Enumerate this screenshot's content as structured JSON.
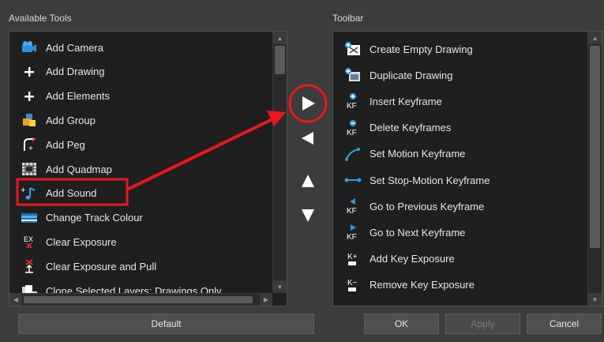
{
  "available_tools": {
    "label": "Available Tools",
    "items": [
      {
        "label": "Add Camera",
        "icon": "camera-icon"
      },
      {
        "label": "Add Drawing",
        "icon": "plus-icon"
      },
      {
        "label": "Add Elements",
        "icon": "plus-icon"
      },
      {
        "label": "Add Group",
        "icon": "group-icon"
      },
      {
        "label": "Add Peg",
        "icon": "peg-icon"
      },
      {
        "label": "Add Quadmap",
        "icon": "quadmap-icon"
      },
      {
        "label": "Add Sound",
        "icon": "sound-icon"
      },
      {
        "label": "Change Track Colour",
        "icon": "track-colour-icon"
      },
      {
        "label": "Clear Exposure",
        "icon": "clear-exposure-icon"
      },
      {
        "label": "Clear Exposure and Pull",
        "icon": "clear-exposure-pull-icon"
      },
      {
        "label": "Clone Selected Layers: Drawings Only",
        "icon": "clone-layers-icon"
      }
    ]
  },
  "toolbar": {
    "label": "Toolbar",
    "items": [
      {
        "label": "Create Empty Drawing",
        "icon": "create-empty-drawing-icon"
      },
      {
        "label": "Duplicate Drawing",
        "icon": "duplicate-drawing-icon"
      },
      {
        "label": "Insert Keyframe",
        "icon": "insert-keyframe-icon"
      },
      {
        "label": "Delete Keyframes",
        "icon": "delete-keyframe-icon"
      },
      {
        "label": "Set Motion Keyframe",
        "icon": "motion-keyframe-icon"
      },
      {
        "label": "Set Stop-Motion Keyframe",
        "icon": "stop-motion-keyframe-icon"
      },
      {
        "label": "Go to Previous Keyframe",
        "icon": "previous-keyframe-icon"
      },
      {
        "label": "Go to Next Keyframe",
        "icon": "next-keyframe-icon"
      },
      {
        "label": "Add Key Exposure",
        "icon": "add-key-exposure-icon"
      },
      {
        "label": "Remove Key Exposure",
        "icon": "remove-key-exposure-icon"
      }
    ]
  },
  "transfer_buttons": {
    "add": "right-arrow-icon",
    "remove": "left-arrow-icon",
    "move_up": "up-arrow-icon",
    "move_down": "down-arrow-icon"
  },
  "buttons": {
    "default": "Default",
    "ok": "OK",
    "apply": "Apply",
    "cancel": "Cancel"
  },
  "colors": {
    "annotation": "#e8181c",
    "background": "#3c3c3c",
    "list_background": "#1f1f1f",
    "accent_blue": "#2f8fd8"
  }
}
